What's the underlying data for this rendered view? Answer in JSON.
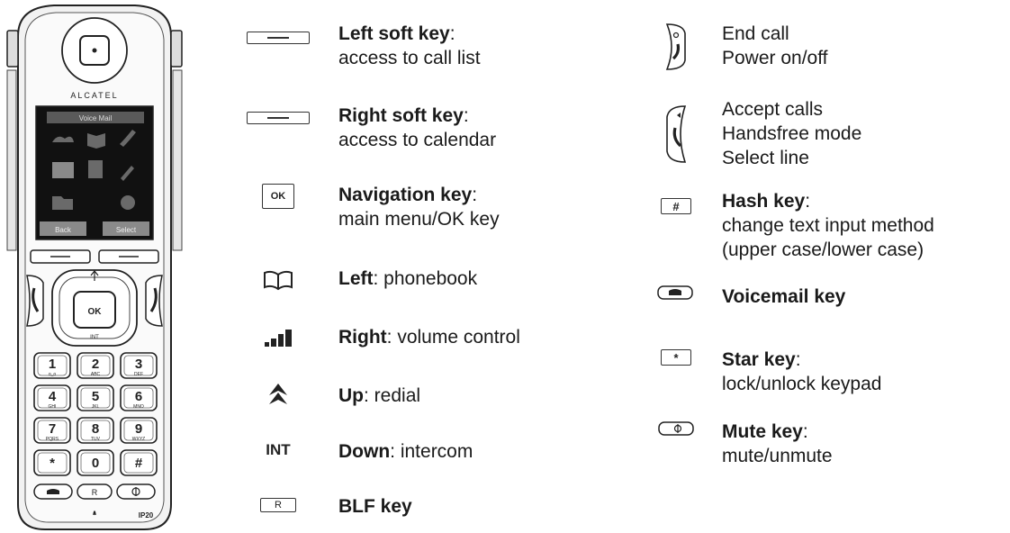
{
  "phone": {
    "brand": "ALCATEL",
    "model": "IP20",
    "screen": {
      "header": "Voice Mail",
      "left_softkey": "Back",
      "right_softkey": "Select"
    },
    "nav": {
      "ok": "OK",
      "down": "INT"
    },
    "keypad": [
      {
        "digit": "1",
        "letters": "o_o"
      },
      {
        "digit": "2",
        "letters": "ABC"
      },
      {
        "digit": "3",
        "letters": "DEF"
      },
      {
        "digit": "4",
        "letters": "GHI"
      },
      {
        "digit": "5",
        "letters": "JKL"
      },
      {
        "digit": "6",
        "letters": "MNO"
      },
      {
        "digit": "7",
        "letters": "PQRS"
      },
      {
        "digit": "8",
        "letters": "TUV"
      },
      {
        "digit": "9",
        "letters": "WXYZ"
      },
      {
        "digit": "*",
        "letters": ""
      },
      {
        "digit": "0",
        "letters": ""
      },
      {
        "digit": "#",
        "letters": ""
      }
    ],
    "bottom_keys": [
      "voicemail",
      "R",
      "mute"
    ]
  },
  "legend_left": [
    {
      "icon": "soft-key-icon",
      "title": "Left soft key",
      "sep": ":",
      "rest": "",
      "line2": "access to call list"
    },
    {
      "icon": "soft-key-icon",
      "title": "Right soft key",
      "sep": ":",
      "rest": "",
      "line2": "access to calendar"
    },
    {
      "icon": "ok-key-icon",
      "icon_text": "OK",
      "title": "Navigation key",
      "sep": ":",
      "rest": "",
      "line2": "main menu/OK key"
    },
    {
      "icon": "phonebook-icon",
      "title": "Left",
      "sep": ":",
      "rest": " phonebook",
      "line2": ""
    },
    {
      "icon": "volume-icon",
      "title": "Right",
      "sep": ":",
      "rest": " volume control",
      "line2": ""
    },
    {
      "icon": "redial-icon",
      "title": "Up",
      "sep": ":",
      "rest": " redial",
      "line2": ""
    },
    {
      "icon": "intercom-icon",
      "icon_text": "INT",
      "title": "Down",
      "sep": ":",
      "rest": " intercom",
      "line2": ""
    },
    {
      "icon": "blf-key-icon",
      "icon_text": "R",
      "title": "BLF key",
      "sep": "",
      "rest": "",
      "line2": ""
    }
  ],
  "legend_right": [
    {
      "icon": "end-call-icon",
      "lines": [
        "End call",
        "Power on/off"
      ]
    },
    {
      "icon": "accept-call-icon",
      "lines": [
        "Accept calls",
        "Handsfree mode",
        "Select line"
      ]
    },
    {
      "icon": "hash-key-icon",
      "icon_text": "#",
      "title": "Hash key",
      "sep": ":",
      "lines": [
        "change text input method",
        "(upper case/lower case)"
      ]
    },
    {
      "icon": "voicemail-key-icon",
      "title": "Voicemail key",
      "sep": "",
      "lines": []
    },
    {
      "icon": "star-key-icon",
      "icon_text": "*",
      "title": "Star key",
      "sep": ":",
      "lines": [
        "lock/unlock keypad"
      ]
    },
    {
      "icon": "mute-key-icon",
      "title": "Mute key",
      "sep": ":",
      "lines": [
        "mute/unmute"
      ]
    }
  ]
}
